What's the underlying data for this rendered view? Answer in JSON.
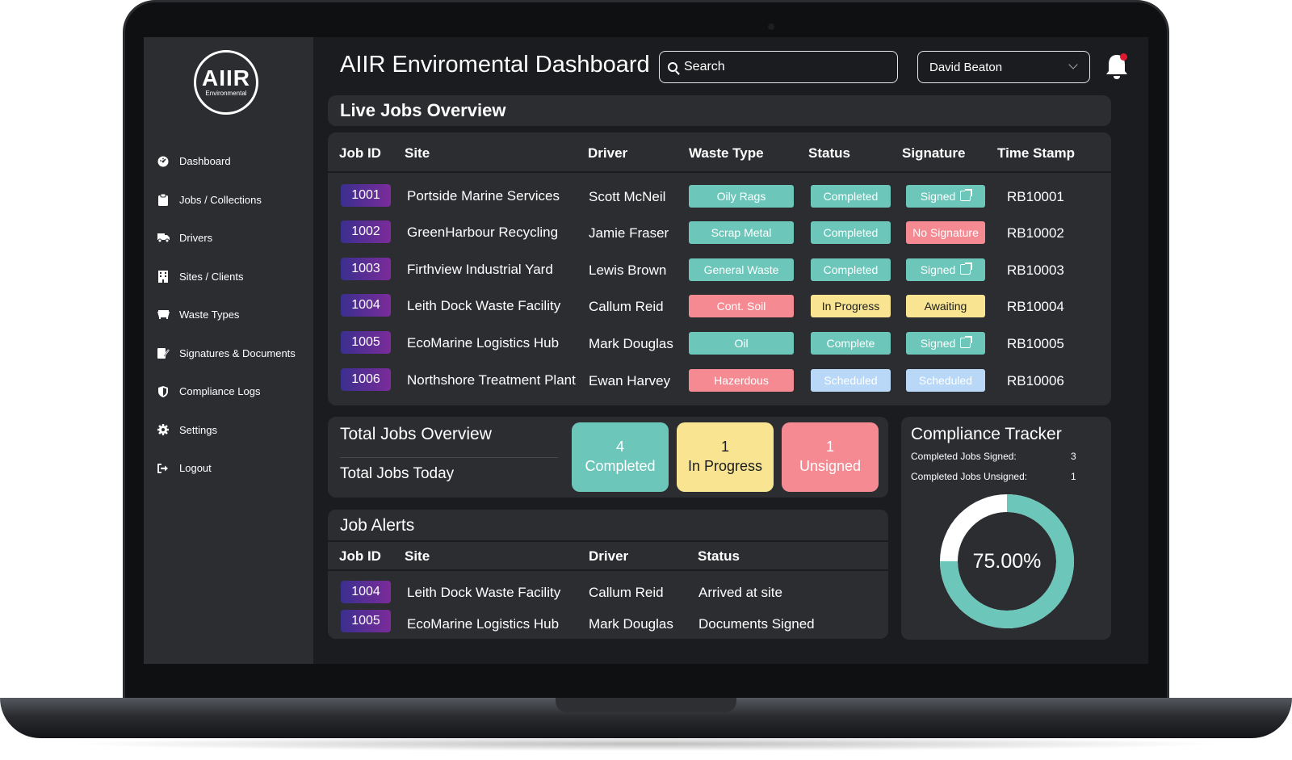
{
  "app": {
    "title": "AIIR Enviromental Dashboard",
    "logo_text": "AIIR",
    "logo_sub": "Environmental"
  },
  "search": {
    "placeholder": "Search"
  },
  "user": {
    "name": "David Beaton"
  },
  "sidebar": {
    "items": [
      {
        "label": "Dashboard",
        "icon": "dashboard-icon"
      },
      {
        "label": "Jobs / Collections",
        "icon": "clipboard-icon"
      },
      {
        "label": "Drivers",
        "icon": "truck-icon"
      },
      {
        "label": "Sites / Clients",
        "icon": "building-icon"
      },
      {
        "label": "Waste Types",
        "icon": "dumpster-icon"
      },
      {
        "label": "Signatures & Documents",
        "icon": "signature-icon"
      },
      {
        "label": "Compliance Logs",
        "icon": "shield-icon"
      },
      {
        "label": "Settings",
        "icon": "gear-icon"
      },
      {
        "label": "Logout",
        "icon": "logout-icon"
      }
    ]
  },
  "live_jobs": {
    "title": "Live Jobs Overview",
    "columns": [
      "Job ID",
      "Site",
      "Driver",
      "Waste Type",
      "Status",
      "Signature",
      "Time Stamp"
    ],
    "rows": [
      {
        "id": "1001",
        "site": "Portside Marine Services",
        "driver": "Scott McNeil",
        "waste": "Oily Rags",
        "waste_color": "#6cc6b9",
        "status": "Completed",
        "status_color": "#6cc6b9",
        "signature": "Signed",
        "signature_color": "#6cc6b9",
        "signature_link": true,
        "timestamp": "RB10001"
      },
      {
        "id": "1002",
        "site": "GreenHarbour Recycling",
        "driver": "Jamie Fraser",
        "waste": "Scrap Metal",
        "waste_color": "#6cc6b9",
        "status": "Completed",
        "status_color": "#6cc6b9",
        "signature": "No Signature",
        "signature_color": "#f58a92",
        "signature_link": false,
        "timestamp": "RB10002"
      },
      {
        "id": "1003",
        "site": "Firthview Industrial Yard",
        "driver": "Lewis Brown",
        "waste": "General Waste",
        "waste_color": "#6cc6b9",
        "status": "Completed",
        "status_color": "#6cc6b9",
        "signature": "Signed",
        "signature_color": "#6cc6b9",
        "signature_link": true,
        "timestamp": "RB10003"
      },
      {
        "id": "1004",
        "site": "Leith Dock Waste Facility",
        "driver": "Callum Reid",
        "waste": "Cont. Soil",
        "waste_color": "#f58a92",
        "status": "In Progress",
        "status_color": "#f8e491",
        "signature": "Awaiting",
        "signature_color": "#f8e491",
        "signature_link": false,
        "timestamp": "RB10004"
      },
      {
        "id": "1005",
        "site": "EcoMarine Logistics Hub",
        "driver": "Mark Douglas",
        "waste": "Oil",
        "waste_color": "#6cc6b9",
        "status": "Complete",
        "status_color": "#6cc6b9",
        "signature": "Signed",
        "signature_color": "#6cc6b9",
        "signature_link": true,
        "timestamp": "RB10005"
      },
      {
        "id": "1006",
        "site": "Northshore Treatment Plant",
        "driver": "Ewan Harvey",
        "waste": "Hazerdous",
        "waste_color": "#f58a92",
        "status": "Scheduled",
        "status_color": "#b9d8f7",
        "signature": "Scheduled",
        "signature_color": "#b9d8f7",
        "signature_link": false,
        "timestamp": "RB10006"
      }
    ]
  },
  "totals": {
    "title": "Total Jobs Overview",
    "subtitle": "Total Jobs Today",
    "completed": {
      "count": "4",
      "label": "Completed"
    },
    "in_progress": {
      "count": "1",
      "label": "In Progress"
    },
    "unsigned": {
      "count": "1",
      "label": "Unsigned"
    }
  },
  "alerts": {
    "title": "Job Alerts",
    "columns": [
      "Job ID",
      "Site",
      "Driver",
      "Status"
    ],
    "rows": [
      {
        "id": "1004",
        "site": "Leith Dock Waste Facility",
        "driver": "Callum Reid",
        "status": "Arrived at site"
      },
      {
        "id": "1005",
        "site": "EcoMarine Logistics Hub",
        "driver": "Mark Douglas",
        "status": "Documents Signed"
      }
    ]
  },
  "compliance": {
    "title": "Compliance Tracker",
    "signed_label": "Completed Jobs Signed:",
    "signed_value": "3",
    "unsigned_label": "Completed Jobs Unsigned:",
    "unsigned_value": "1",
    "percent_label": "75.00%",
    "fraction": 0.75,
    "ring_color": "#6cc6b9",
    "ring_rest_color": "#ffffff"
  }
}
